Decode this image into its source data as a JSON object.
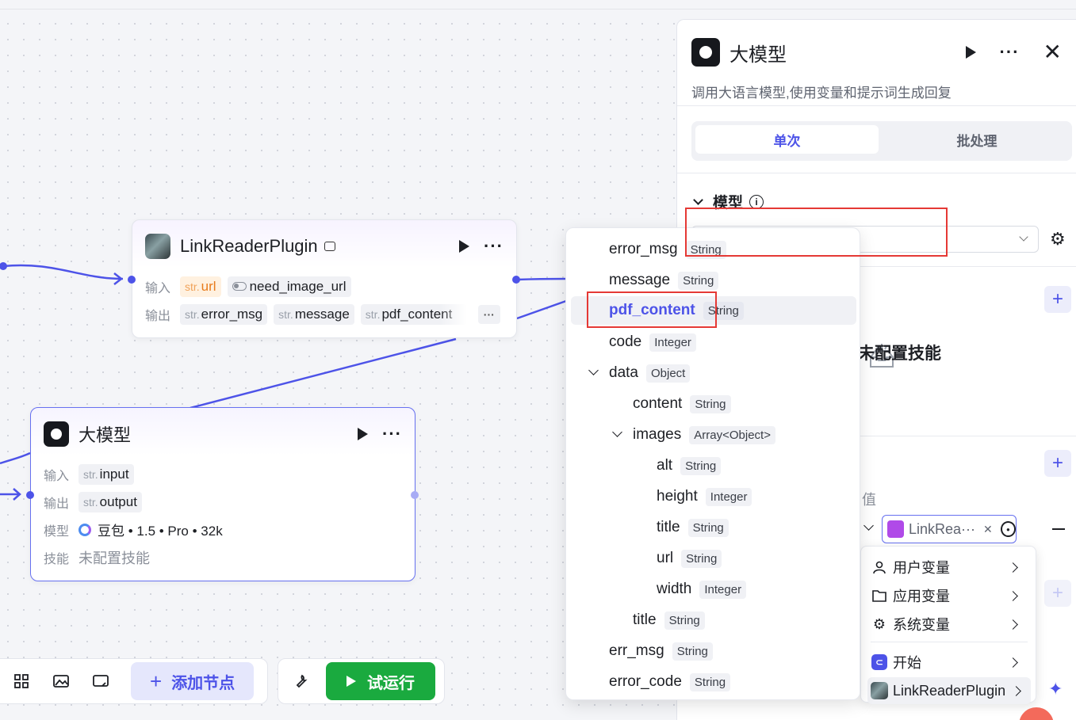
{
  "canvas": {
    "link_node": {
      "title": "LinkReaderPlugin",
      "input_label": "输入",
      "output_label": "输出",
      "inputs": [
        {
          "prefix": "str.",
          "name": "url",
          "style": "orange"
        },
        {
          "prefix": "",
          "name": "need_image_url",
          "style": "toggle"
        }
      ],
      "outputs": [
        {
          "prefix": "str.",
          "name": "error_msg"
        },
        {
          "prefix": "str.",
          "name": "message"
        },
        {
          "prefix": "str.",
          "name": "pdf_content"
        }
      ],
      "more": "···"
    },
    "llm_node": {
      "title": "大模型",
      "input_label": "输入",
      "output_label": "输出",
      "model_label": "模型",
      "skill_label": "技能",
      "input": {
        "prefix": "str.",
        "name": "input"
      },
      "output": {
        "prefix": "str.",
        "name": "output"
      },
      "model_value": "豆包 • 1.5 • Pro • 32k",
      "skill_value": "未配置技能"
    }
  },
  "toolbar": {
    "add_node": "添加节点",
    "run": "试运行",
    "icons": [
      "grid-icon",
      "image-icon",
      "comment-icon",
      "wrench-icon"
    ]
  },
  "panel": {
    "title": "大模型",
    "description": "调用大语言模型,使用变量和提示词生成回复",
    "tabs": [
      {
        "label": "单次",
        "active": true
      },
      {
        "label": "批处理",
        "active": false
      }
    ],
    "model_section": "模型",
    "empty_skill": "未配置技能",
    "value_label": "值",
    "var_chip": "LinkRea···"
  },
  "var_menu": {
    "items": [
      {
        "icon": "user-icon",
        "label": "用户变量"
      },
      {
        "icon": "folder-icon",
        "label": "应用变量"
      },
      {
        "icon": "gear-icon",
        "label": "系统变量"
      },
      {
        "icon": "start-icon",
        "label": "开始"
      },
      {
        "icon": "plugin-icon",
        "label": "LinkReaderPlugin"
      }
    ]
  },
  "field_menu": {
    "rows": [
      {
        "name": "error_msg",
        "type": "String",
        "level": 0
      },
      {
        "name": "message",
        "type": "String",
        "level": 0
      },
      {
        "name": "pdf_content",
        "type": "String",
        "level": 0,
        "selected": true
      },
      {
        "name": "code",
        "type": "Integer",
        "level": 0
      },
      {
        "name": "data",
        "type": "Object",
        "level": 0,
        "expanded": true
      },
      {
        "name": "content",
        "type": "String",
        "level": 1
      },
      {
        "name": "images",
        "type": "Array<Object>",
        "level": 1,
        "expanded": true
      },
      {
        "name": "alt",
        "type": "String",
        "level": 2
      },
      {
        "name": "height",
        "type": "Integer",
        "level": 2
      },
      {
        "name": "title",
        "type": "String",
        "level": 2
      },
      {
        "name": "url",
        "type": "String",
        "level": 2
      },
      {
        "name": "width",
        "type": "Integer",
        "level": 2
      },
      {
        "name": "title",
        "type": "String",
        "level": 1
      },
      {
        "name": "err_msg",
        "type": "String",
        "level": 0
      },
      {
        "name": "error_code",
        "type": "String",
        "level": 0
      }
    ]
  },
  "colors": {
    "accent": "#4d53e8",
    "run_green": "#1aaa3f",
    "highlight_red": "#e53935",
    "orange_tag": "#e87b1c"
  }
}
